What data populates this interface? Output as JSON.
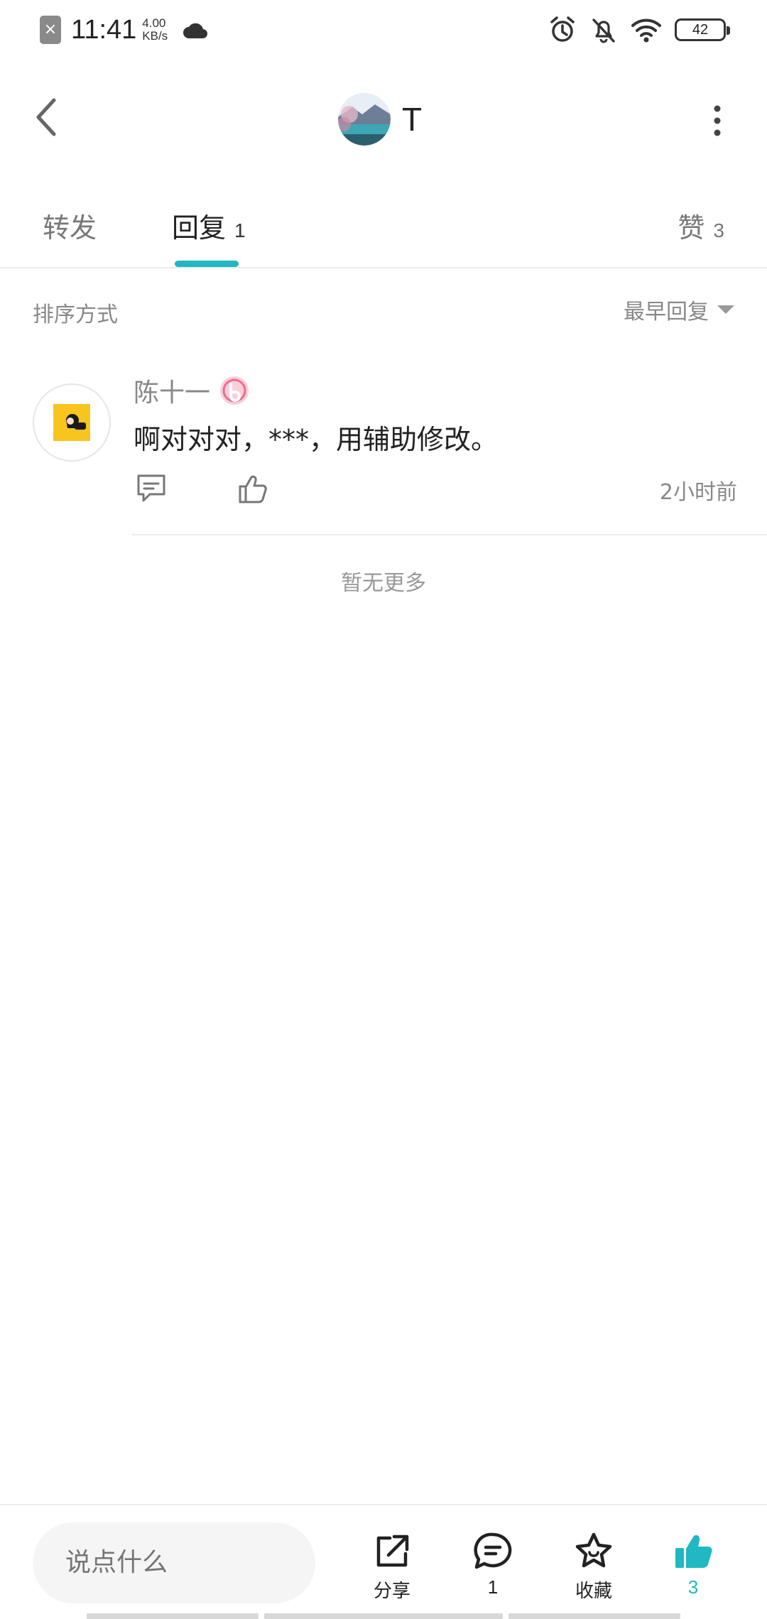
{
  "status_bar": {
    "time": "11:41",
    "net_speed_value": "4.00",
    "net_speed_unit": "KB/s",
    "battery": "42",
    "icons": [
      "sim-off-icon",
      "cloud-icon",
      "alarm-icon",
      "bell-off-icon",
      "wifi-icon",
      "battery-icon"
    ]
  },
  "header": {
    "title": "T",
    "icons": [
      "back-arrow-icon",
      "profile-avatar",
      "more-vertical-icon"
    ]
  },
  "tabs": {
    "forward_label": "转发",
    "reply_label": "回复",
    "reply_count": "1",
    "like_label": "赞",
    "like_count": "3",
    "accent_color": "#1fb8c3"
  },
  "sort": {
    "label": "排序方式",
    "selected": "最早回复"
  },
  "comments": [
    {
      "author": "陈十一",
      "text": "啊对对对，***，用辅助修改。",
      "time": "2小时前"
    }
  ],
  "list_end_text": "暂无更多",
  "bottom_bar": {
    "input_placeholder": "说点什么",
    "share_label": "分享",
    "comment_count": "1",
    "favorite_label": "收藏",
    "like_count": "3"
  }
}
